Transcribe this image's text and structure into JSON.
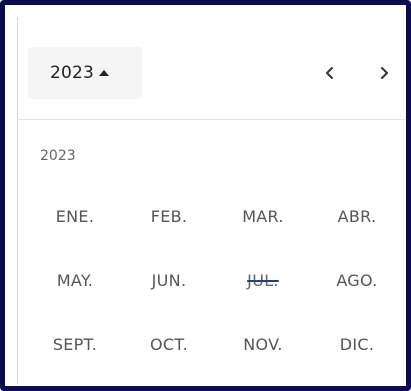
{
  "header": {
    "year_label": "2023",
    "caret_icon": "caret-up-icon",
    "prev_icon": "chevron-left-icon",
    "next_icon": "chevron-right-icon"
  },
  "section_label": "2023",
  "months": [
    [
      "ENE.",
      "FEB.",
      "MAR.",
      "ABR."
    ],
    [
      "MAY.",
      "JUN.",
      "JUL.",
      "AGO."
    ],
    [
      "SEPT.",
      "OCT.",
      "NOV.",
      "DIC."
    ]
  ],
  "disabled_months": [
    "JUL."
  ],
  "colors": {
    "frame_border": "#0b0b52",
    "toggle_bg": "#f5f5f5",
    "strike": "#2d3e6f"
  }
}
